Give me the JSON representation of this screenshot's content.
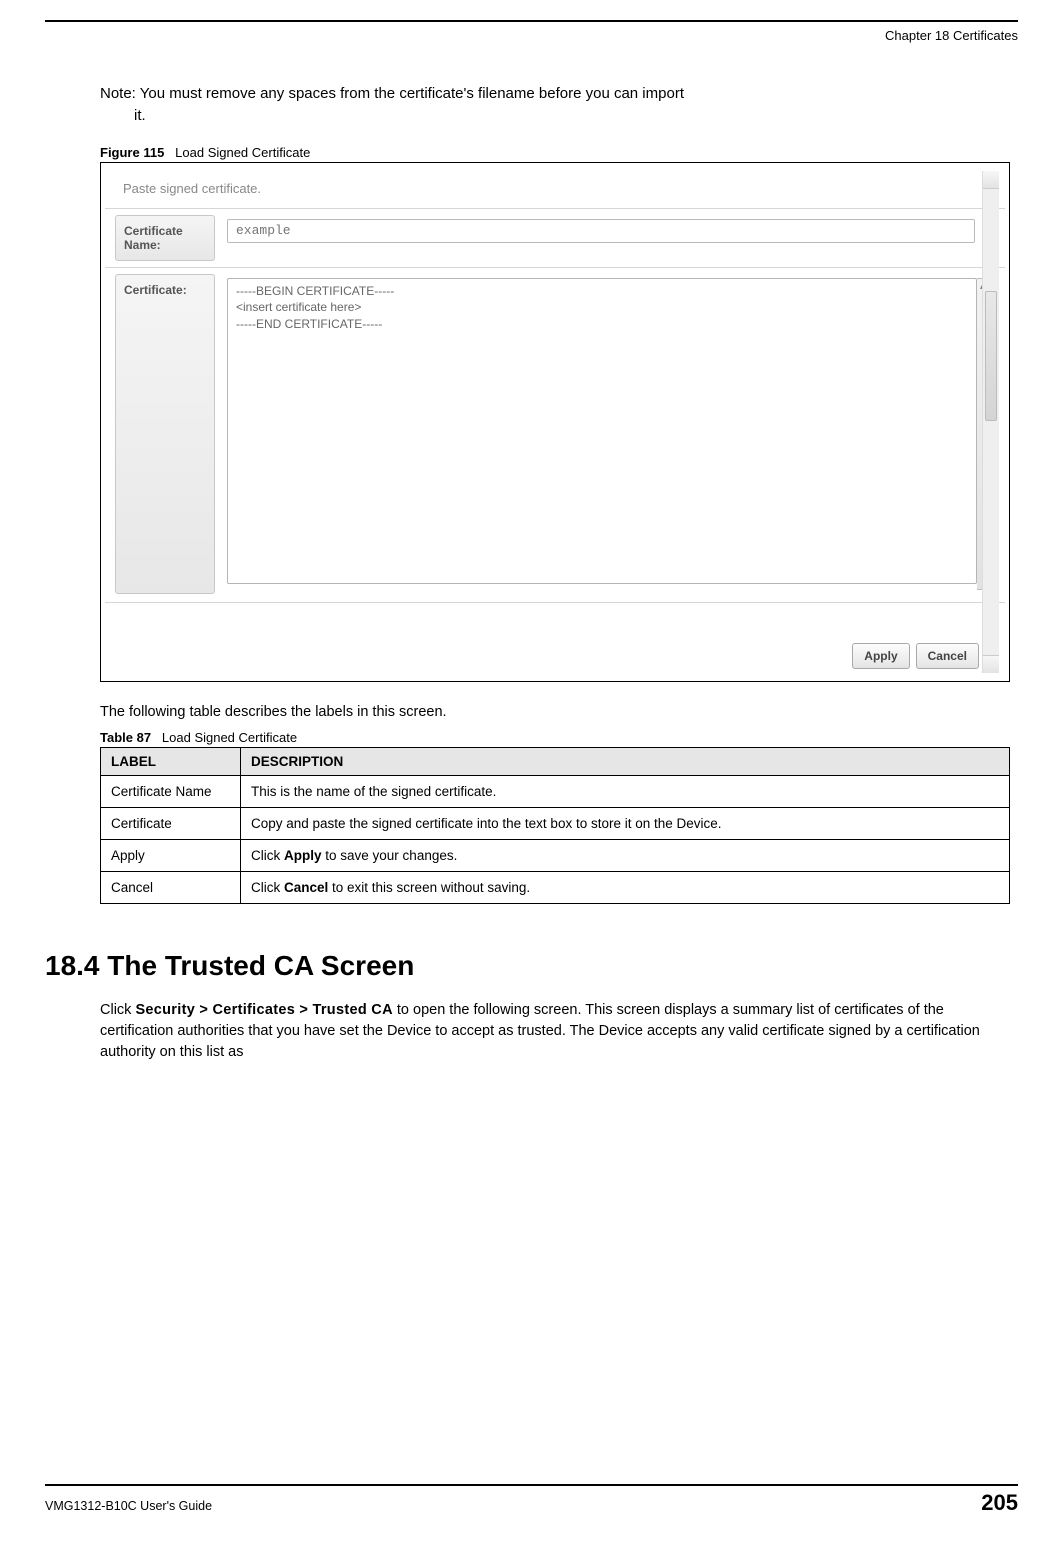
{
  "header": {
    "chapter": "Chapter 18 Certificates"
  },
  "note": {
    "line1": "Note: You must remove any spaces from the certificate's filename before you can import",
    "line2": "it."
  },
  "figure": {
    "caption_label": "Figure 115",
    "caption_title": "Load Signed Certificate",
    "ui": {
      "instruction": "Paste signed certificate.",
      "label_cert_name": "Certificate Name:",
      "label_cert": "Certificate:",
      "cert_name_placeholder": "example",
      "cert_textarea_value": "-----BEGIN CERTIFICATE-----\n<insert certificate here>\n-----END CERTIFICATE-----",
      "btn_apply": "Apply",
      "btn_cancel": "Cancel"
    }
  },
  "intro_para": "The following table describes the labels in this screen.",
  "table": {
    "caption_label": "Table 87",
    "caption_title": "Load Signed Certificate",
    "head_label": "LABEL",
    "head_desc": "DESCRIPTION",
    "rows": [
      {
        "label": "Certificate Name",
        "desc_pre": "",
        "desc_bold": "",
        "desc_mid": "This is the name of the signed certificate.",
        "desc_post": ""
      },
      {
        "label": "Certificate",
        "desc_pre": "",
        "desc_bold": "",
        "desc_mid": "Copy and paste the signed certificate into the text box to store it on the Device.",
        "desc_post": ""
      },
      {
        "label": "Apply",
        "desc_pre": "Click ",
        "desc_bold": "Apply",
        "desc_mid": "",
        "desc_post": " to save your changes."
      },
      {
        "label": "Cancel",
        "desc_pre": "Click ",
        "desc_bold": "Cancel",
        "desc_mid": "",
        "desc_post": " to exit this screen without saving."
      }
    ]
  },
  "section": {
    "heading": "18.4  The Trusted CA Screen",
    "para_pre": "Click ",
    "nav_bold": "Security > Certificates > Trusted CA",
    "para_post": " to open the following screen. This screen displays a summary list of certificates of the certification authorities that you have set the Device to accept as trusted. The Device accepts any valid certificate signed by a certification authority on this list as"
  },
  "footer": {
    "guide": "VMG1312-B10C User's Guide",
    "page": "205"
  }
}
